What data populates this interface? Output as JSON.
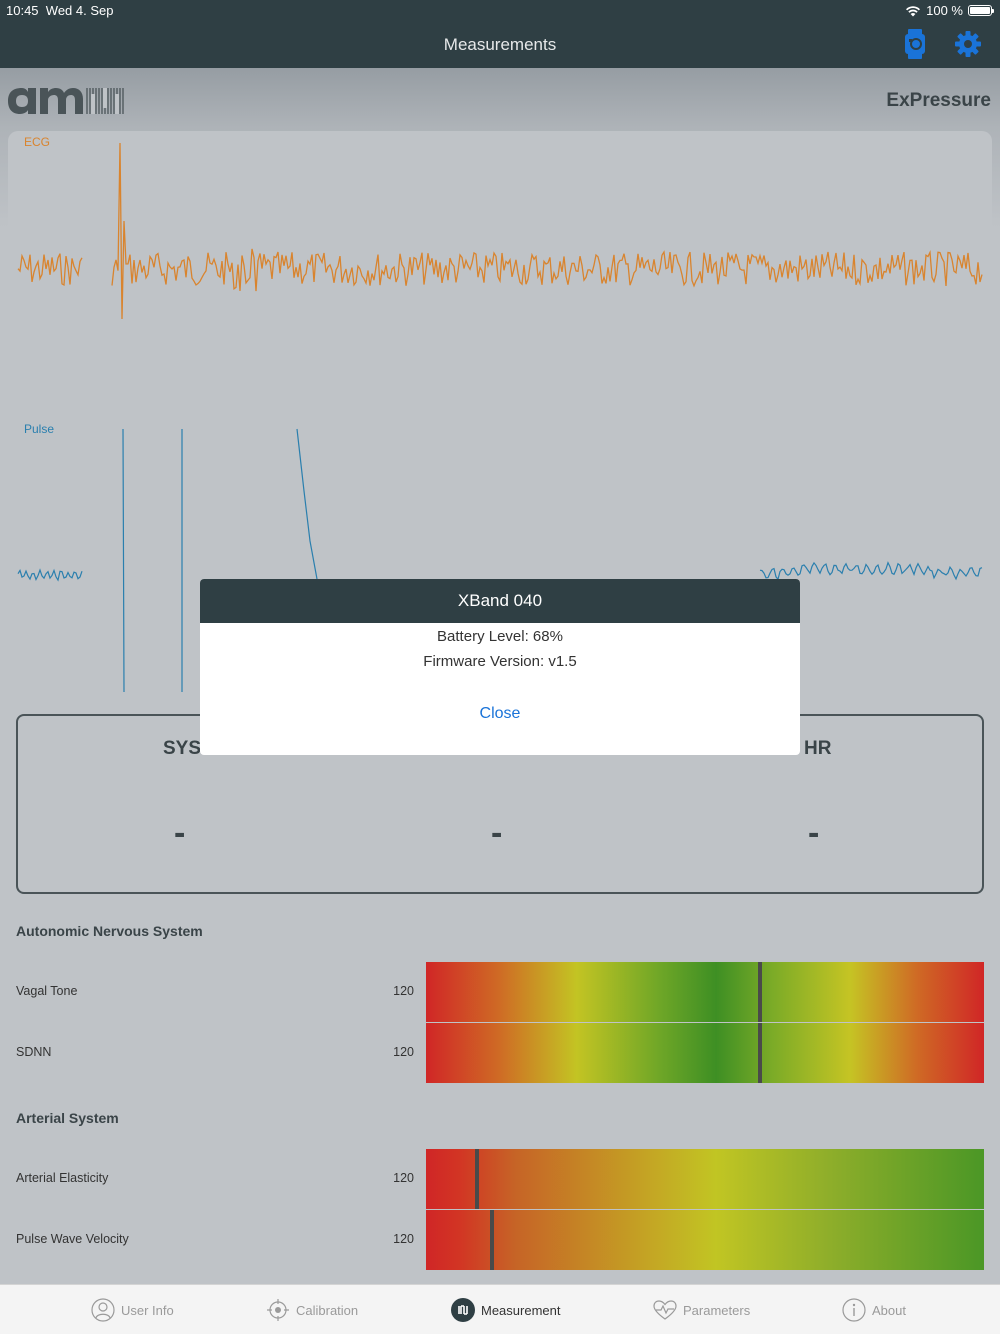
{
  "status_bar": {
    "time": "10:45",
    "date": "Wed 4. Sep",
    "battery": "100 %"
  },
  "nav": {
    "title": "Measurements",
    "watch_icon": "watch-icon",
    "settings_icon": "gear-icon",
    "accent": "#1a73d8"
  },
  "brand": {
    "logo": "ams",
    "app_name": "ExPressure"
  },
  "charts": {
    "ecg_label": "ECG",
    "ecg_color": "#d9842e",
    "pulse_label": "Pulse",
    "pulse_color": "#2a7fae"
  },
  "vitals": {
    "sys_label": "SYS",
    "hr_label": "HR",
    "sys_value": "-",
    "mid_value": "-",
    "hr_value": "-"
  },
  "autonomic": {
    "title": "Autonomic Nervous System",
    "rows": [
      {
        "label": "Vagal Tone",
        "value": "120",
        "level": 0.6
      },
      {
        "label": "SDNN",
        "value": "120",
        "level": 0.6
      }
    ]
  },
  "arterial": {
    "title": "Arterial System",
    "rows": [
      {
        "label": "Arterial Elasticity",
        "value": "120",
        "level": 0.088
      },
      {
        "label": "Pulse Wave Velocity",
        "value": "120",
        "level": 0.115
      }
    ]
  },
  "dialog": {
    "title": "XBand 040",
    "battery": "Battery Level: 68%",
    "firmware": "Firmware Version: v1.5",
    "close_label": "Close"
  },
  "tabs": [
    {
      "label": "User Info",
      "icon": "user-icon"
    },
    {
      "label": "Calibration",
      "icon": "target-icon"
    },
    {
      "label": "Measurement",
      "icon": "ams-measure-icon"
    },
    {
      "label": "Parameters",
      "icon": "heartbeat-icon"
    },
    {
      "label": "About",
      "icon": "info-icon"
    }
  ]
}
